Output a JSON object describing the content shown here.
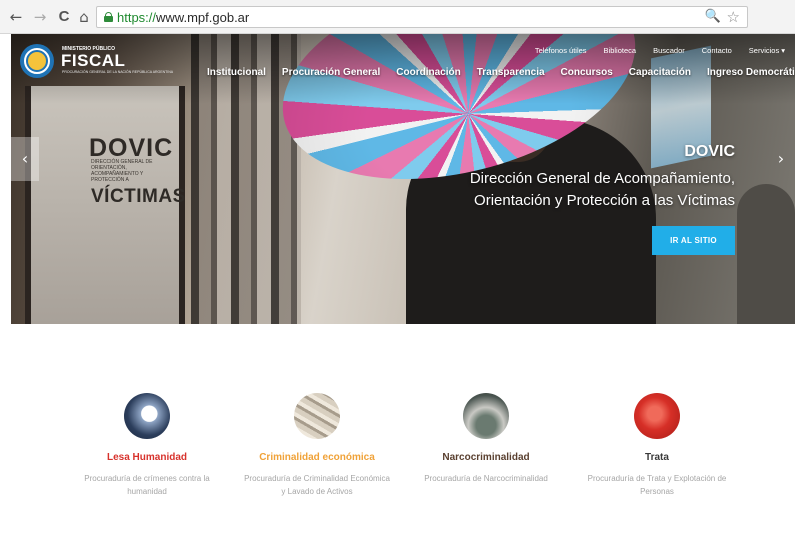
{
  "browser": {
    "back": "←",
    "forward": "→",
    "reload": "C",
    "home": "⌂",
    "url_scheme": "https://",
    "url_host": "www.mpf.gob.ar",
    "zoom_glyph": "🔍",
    "star_glyph": "☆"
  },
  "logo": {
    "superscript": "MINISTERIO PÚBLICO",
    "main": "FISCAL",
    "sub": "PROCURACIÓN GENERAL DE LA NACIÓN REPÚBLICA ARGENTINA"
  },
  "utility_nav": [
    "Teléfonos útiles",
    "Biblioteca",
    "Buscador",
    "Contacto",
    "Servicios"
  ],
  "utility_caret": "▾",
  "main_nav": [
    "Institucional",
    "Procuración General",
    "Coordinación",
    "Transparencia",
    "Concursos",
    "Capacitación",
    "Ingreso Democrático"
  ],
  "hero": {
    "door_title": "DOVIC",
    "door_subtitle": "DIRECCIÓN GENERAL DE ORIENTACIÓN, ACOMPAÑAMIENTO Y PROTECCIÓN A",
    "door_word": "VÍCTIMAS",
    "caption_title": "DOVIC",
    "caption_text": "Dirección General de Acompañamiento, Orientación y Protección a las Víctimas",
    "cta": "IR AL SITIO",
    "prev": "‹",
    "next": "›"
  },
  "features": [
    {
      "title": "Lesa Humanidad",
      "desc": "Procuraduría de crímenes contra la humanidad"
    },
    {
      "title": "Criminalidad económica",
      "desc": "Procuraduría de Criminalidad Económica y Lavado de Activos"
    },
    {
      "title": "Narcocriminalidad",
      "desc": "Procuraduría de Narcocriminalidad"
    },
    {
      "title": "Trata",
      "desc": "Procuraduría de Trata y Explotación de Personas"
    }
  ],
  "colors": {
    "lesa": "#d7322c",
    "criminalidad": "#f0a238",
    "narco": "#5a4030",
    "trata": "#3a3a3a",
    "cta": "#21aee8",
    "logo_blue": "#1f73b5"
  }
}
